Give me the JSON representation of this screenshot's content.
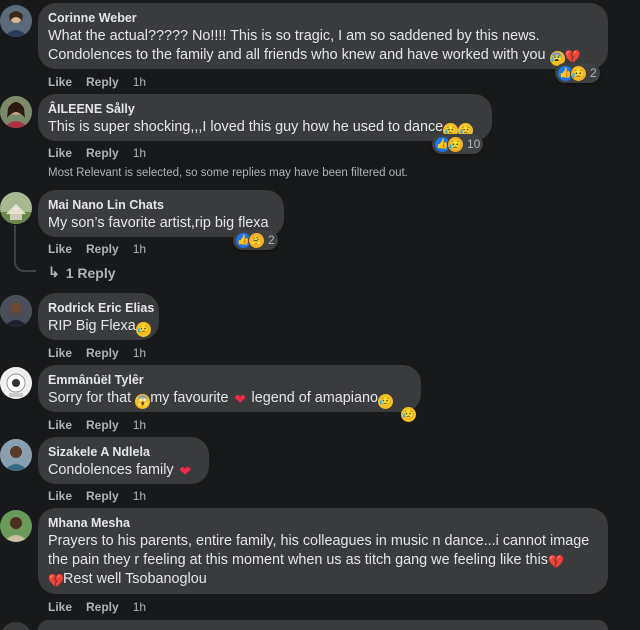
{
  "comments": [
    {
      "author": "Corinne Weber",
      "lines": [
        "What the actual????? No!!!! This is so tragic, I am so saddened by this news.",
        "Condolences to the family and all friends who knew and have worked with you"
      ],
      "like": "Like",
      "reply": "Reply",
      "time": "1h",
      "reaction_count": "2"
    },
    {
      "author": "ÂILEENE Sålly",
      "lines": [
        "This is super shocking,,,I loved this guy how he used to dance"
      ],
      "like": "Like",
      "reply": "Reply",
      "time": "1h",
      "reaction_count": "10"
    },
    {
      "author": "Mai Nano Lin Chats",
      "lines": [
        "My son’s favorite artist,rip big flexa"
      ],
      "like": "Like",
      "reply": "Reply",
      "time": "1h",
      "reaction_count": "2"
    },
    {
      "author": "Rodrick Eric Elias",
      "lines": [
        "RIP Big Flexa"
      ],
      "like": "Like",
      "reply": "Reply",
      "time": "1h"
    },
    {
      "author": "Emmânûël Tylêr",
      "lines": [
        "Sorry for that ",
        "my favourite ",
        " legend of amapiano"
      ],
      "like": "Like",
      "reply": "Reply",
      "time": "1h"
    },
    {
      "author": "Sizakele A Ndlela",
      "lines": [
        "Condolences family "
      ],
      "like": "Like",
      "reply": "Reply",
      "time": "1h"
    },
    {
      "author": "Mhana Mesha",
      "lines": [
        "Prayers to his parents, entire family, his colleagues in music n dance...i cannot image",
        "the pain they r feeling at this moment when us as titch gang we feeling like this",
        "Rest well Tsobanoglou"
      ],
      "like": "Like",
      "reply": "Reply",
      "time": "1h"
    }
  ],
  "filter_note": "Most Relevant is selected, so some replies may have been filtered out.",
  "replies_link": "1 Reply",
  "colors": {
    "background": "#18191a",
    "bubble": "#3a3b3c",
    "text": "#e4e6eb",
    "secondary": "#b0b3b8",
    "like_blue": "#1877f2",
    "heart_red": "#f02849"
  },
  "icons": [
    "like-reaction-icon",
    "sad-reaction-icon",
    "care-reaction-icon",
    "heart-emoji-icon",
    "broken-heart-emoji-icon",
    "reply-arrow-icon"
  ]
}
